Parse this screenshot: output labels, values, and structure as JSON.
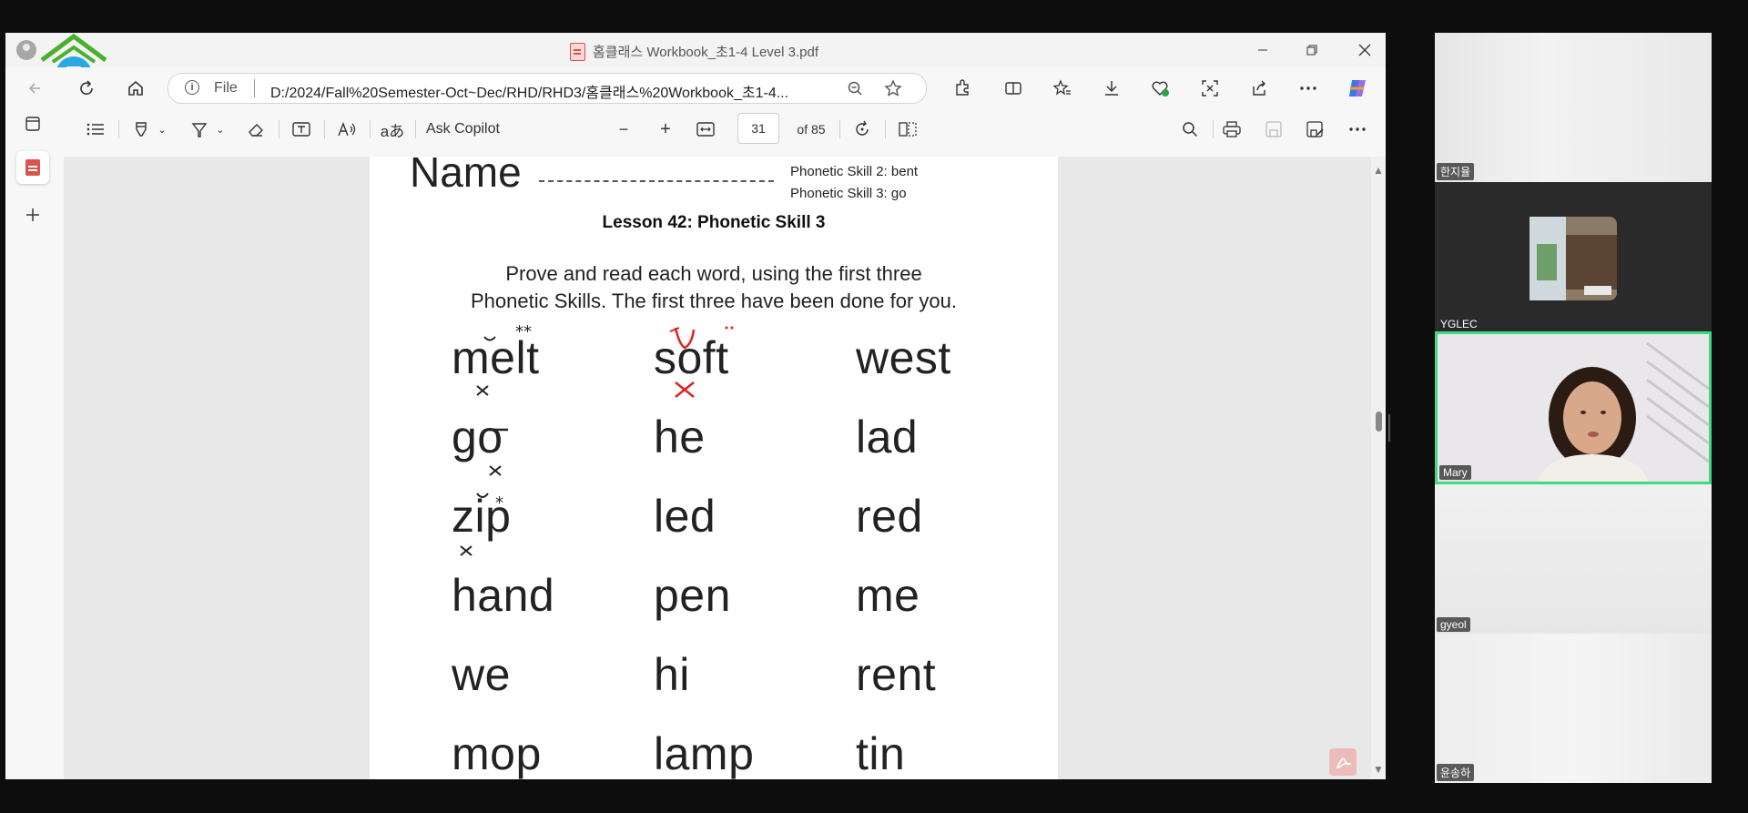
{
  "browser": {
    "tab_title": "홈클래스 Workbook_초1-4 Level 3.pdf",
    "address": {
      "scheme_label": "File",
      "url": "D:/2024/Fall%20Semester-Oct~Dec/RHD/RHD3/홈클래스%20Workbook_초1-4..."
    },
    "icons": [
      "back-icon",
      "refresh-icon",
      "home-icon",
      "info-icon",
      "zoom-icon",
      "favorite-star-icon",
      "extensions-icon",
      "split-screen-icon",
      "favorites-icon",
      "downloads-icon",
      "browser-essentials-icon",
      "screenshot-icon",
      "share-icon",
      "more-icon",
      "copilot-icon"
    ]
  },
  "pdf_toolbar": {
    "ask_copilot": "Ask Copilot",
    "page_number": "31",
    "page_total": "of 85",
    "zoom_out": "−",
    "zoom_in": "+"
  },
  "pdf_page": {
    "name_label": "Name",
    "skill_notes": [
      "Phonetic Skill 2: bent",
      "Phonetic Skill 3: go"
    ],
    "lesson_title": "Lesson 42: Phonetic Skill 3",
    "instructions_line1": "Prove and read each word, using the first three",
    "instructions_line2": "Phonetic Skills. The first three have been done for you.",
    "words": [
      [
        "melt",
        "soft",
        "west"
      ],
      [
        "go",
        "he",
        "lad"
      ],
      [
        "zip",
        "led",
        "red"
      ],
      [
        "hand",
        "pen",
        "me"
      ],
      [
        "we",
        "hi",
        "rent"
      ],
      [
        "mop",
        "lamp",
        "tin"
      ]
    ]
  },
  "participants": [
    {
      "name": "한지율"
    },
    {
      "name": "YGLEC"
    },
    {
      "name": "Mary",
      "active_speaker": true
    },
    {
      "name": "gyeol"
    },
    {
      "name": "윤송하"
    }
  ],
  "colors": {
    "active_speaker_border": "#3ddc84",
    "annotation_red": "#e02020"
  }
}
